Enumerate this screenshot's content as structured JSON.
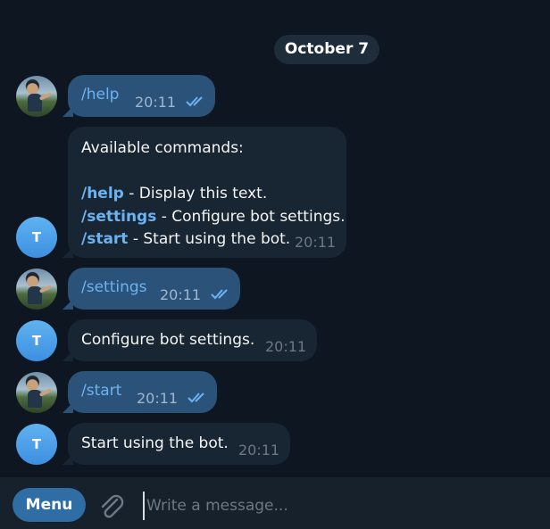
{
  "chat": {
    "date_separator": "October 7",
    "bot_avatar_letter": "T",
    "messages": [
      {
        "direction": "out",
        "text": "/help",
        "time": "20:11",
        "status": "read"
      },
      {
        "direction": "in",
        "intro": "Available commands:",
        "commands": [
          {
            "cmd": "/help",
            "desc": " - Display this text."
          },
          {
            "cmd": "/settings",
            "desc": " - Configure bot settings."
          },
          {
            "cmd": "/start",
            "desc": " - Start using the bot."
          }
        ],
        "time": "20:11"
      },
      {
        "direction": "out",
        "text": "/settings",
        "time": "20:11",
        "status": "read"
      },
      {
        "direction": "in",
        "text": "Configure bot settings.",
        "time": "20:11"
      },
      {
        "direction": "out",
        "text": "/start",
        "time": "20:11",
        "status": "read"
      },
      {
        "direction": "in",
        "text": "Start using the bot.",
        "time": "20:11"
      }
    ]
  },
  "composer": {
    "menu_label": "Menu",
    "placeholder": "Write a message...",
    "attach_icon": "paperclip-icon"
  },
  "colors": {
    "background": "#0e1621",
    "outgoing_bubble": "#2b5278",
    "incoming_bubble": "#182533",
    "link": "#6ab3f3",
    "menu_button": "#2f6ea5"
  }
}
